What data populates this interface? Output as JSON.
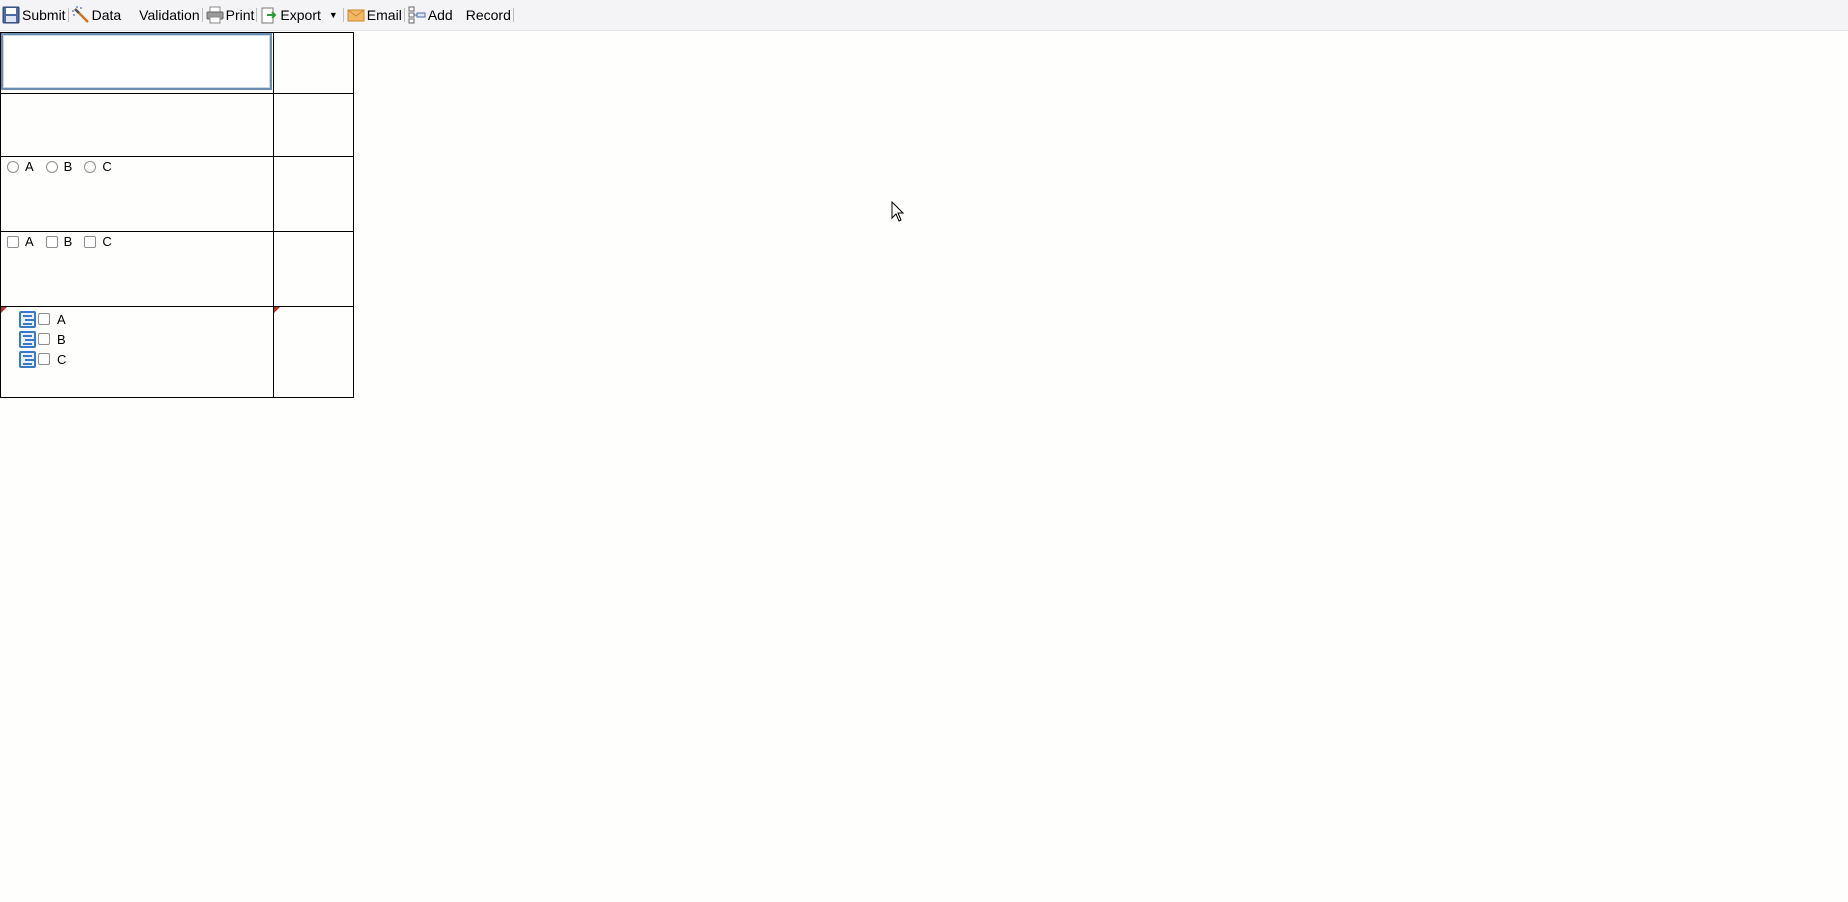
{
  "toolbar": {
    "submit": "Submit",
    "data": "Data",
    "validation": "Validation",
    "print": "Print",
    "export": "Export",
    "email": "Email",
    "add": "Add",
    "record": "Record"
  },
  "form": {
    "text_value": "",
    "radio_options": [
      "A",
      "B",
      "C"
    ],
    "checkbox_options": [
      "A",
      "B",
      "C"
    ],
    "tree_items": [
      "A",
      "B",
      "C"
    ]
  },
  "colors": {
    "toolbar_bg": "#f4f4f6",
    "focus_border": "#6a8db3",
    "tree_icon": "#3a78c8",
    "corner_mark": "#b03a1a"
  },
  "icons": {
    "submit": "floppy-disk-icon",
    "data": "magic-wand-icon",
    "print": "printer-icon",
    "export": "export-icon",
    "email": "envelope-icon",
    "add": "add-row-icon",
    "tree": "list-node-icon"
  }
}
